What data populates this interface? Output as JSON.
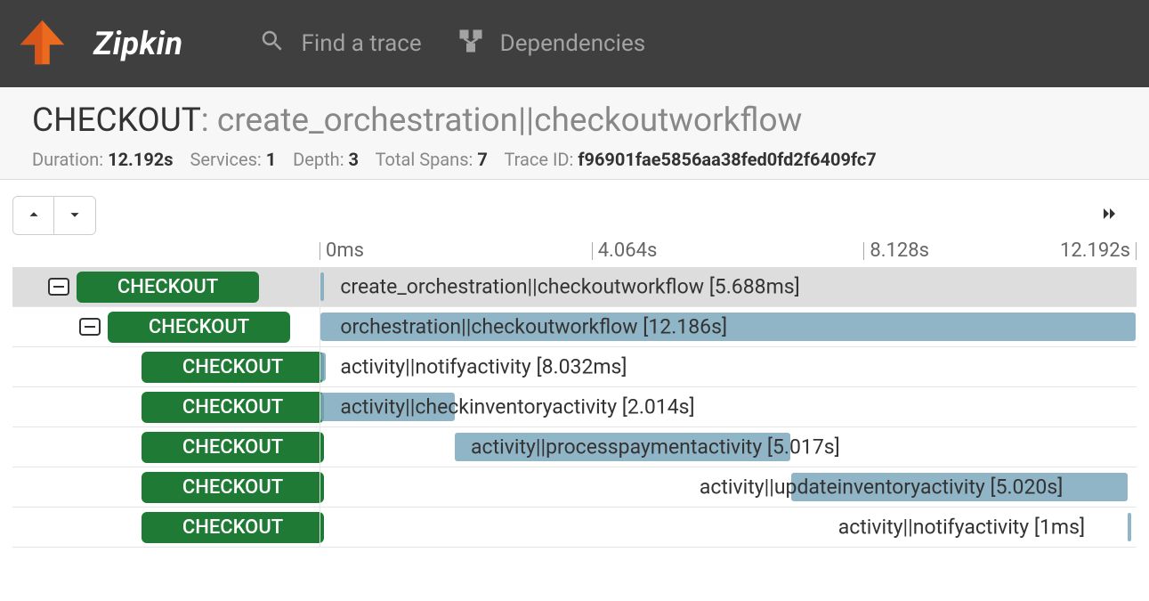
{
  "app": {
    "brand": "Zipkin"
  },
  "nav": {
    "find_trace": "Find a trace",
    "dependencies": "Dependencies"
  },
  "title": {
    "service": "CHECKOUT",
    "operation": "create_orchestration||checkoutworkflow"
  },
  "meta": {
    "duration_label": "Duration:",
    "duration": "12.192s",
    "services_label": "Services:",
    "services": "1",
    "depth_label": "Depth:",
    "depth": "3",
    "spans_label": "Total Spans:",
    "spans": "7",
    "traceid_label": "Trace ID:",
    "traceid": "f96901fae5856aa38fed0fd2f6409fc7"
  },
  "ruler": {
    "t0": "0ms",
    "t1": "4.064s",
    "t2": "8.128s",
    "t3": "12.192s"
  },
  "rows": [
    {
      "indent": 40,
      "toggle": true,
      "service": "CHECKOUT",
      "label": "create_orchestration||checkoutworkflow [5.688ms]",
      "bar_left": 0,
      "bar_width": 0.4,
      "label_left": 2,
      "selected": true
    },
    {
      "indent": 75,
      "toggle": true,
      "service": "CHECKOUT",
      "label": "orchestration||checkoutworkflow [12.186s]",
      "bar_left": 0,
      "bar_width": 99.9,
      "label_left": 2,
      "selected": false
    },
    {
      "indent": 145,
      "toggle": false,
      "service": "CHECKOUT",
      "label": "activity||notifyactivity [8.032ms]",
      "bar_left": 0,
      "bar_width": 0.6,
      "label_left": 2,
      "selected": false
    },
    {
      "indent": 145,
      "toggle": false,
      "service": "CHECKOUT",
      "label": "activity||checkinventoryactivity [2.014s]",
      "bar_left": 0,
      "bar_width": 16.5,
      "label_left": 2,
      "selected": false
    },
    {
      "indent": 145,
      "toggle": false,
      "service": "CHECKOUT",
      "label": "activity||processpaymentactivity [5.017s]",
      "bar_left": 16.5,
      "bar_width": 41.1,
      "label_left": 18,
      "selected": false
    },
    {
      "indent": 145,
      "toggle": false,
      "service": "CHECKOUT",
      "label": "activity||updateinventoryactivity [5.020s]",
      "bar_left": 57.7,
      "bar_width": 41.2,
      "label_left": 46,
      "selected": false
    },
    {
      "indent": 145,
      "toggle": false,
      "service": "CHECKOUT",
      "label": "activity||notifyactivity [1ms]",
      "bar_left": 98.9,
      "bar_width": 0.4,
      "label_left": 63,
      "selected": false
    }
  ]
}
